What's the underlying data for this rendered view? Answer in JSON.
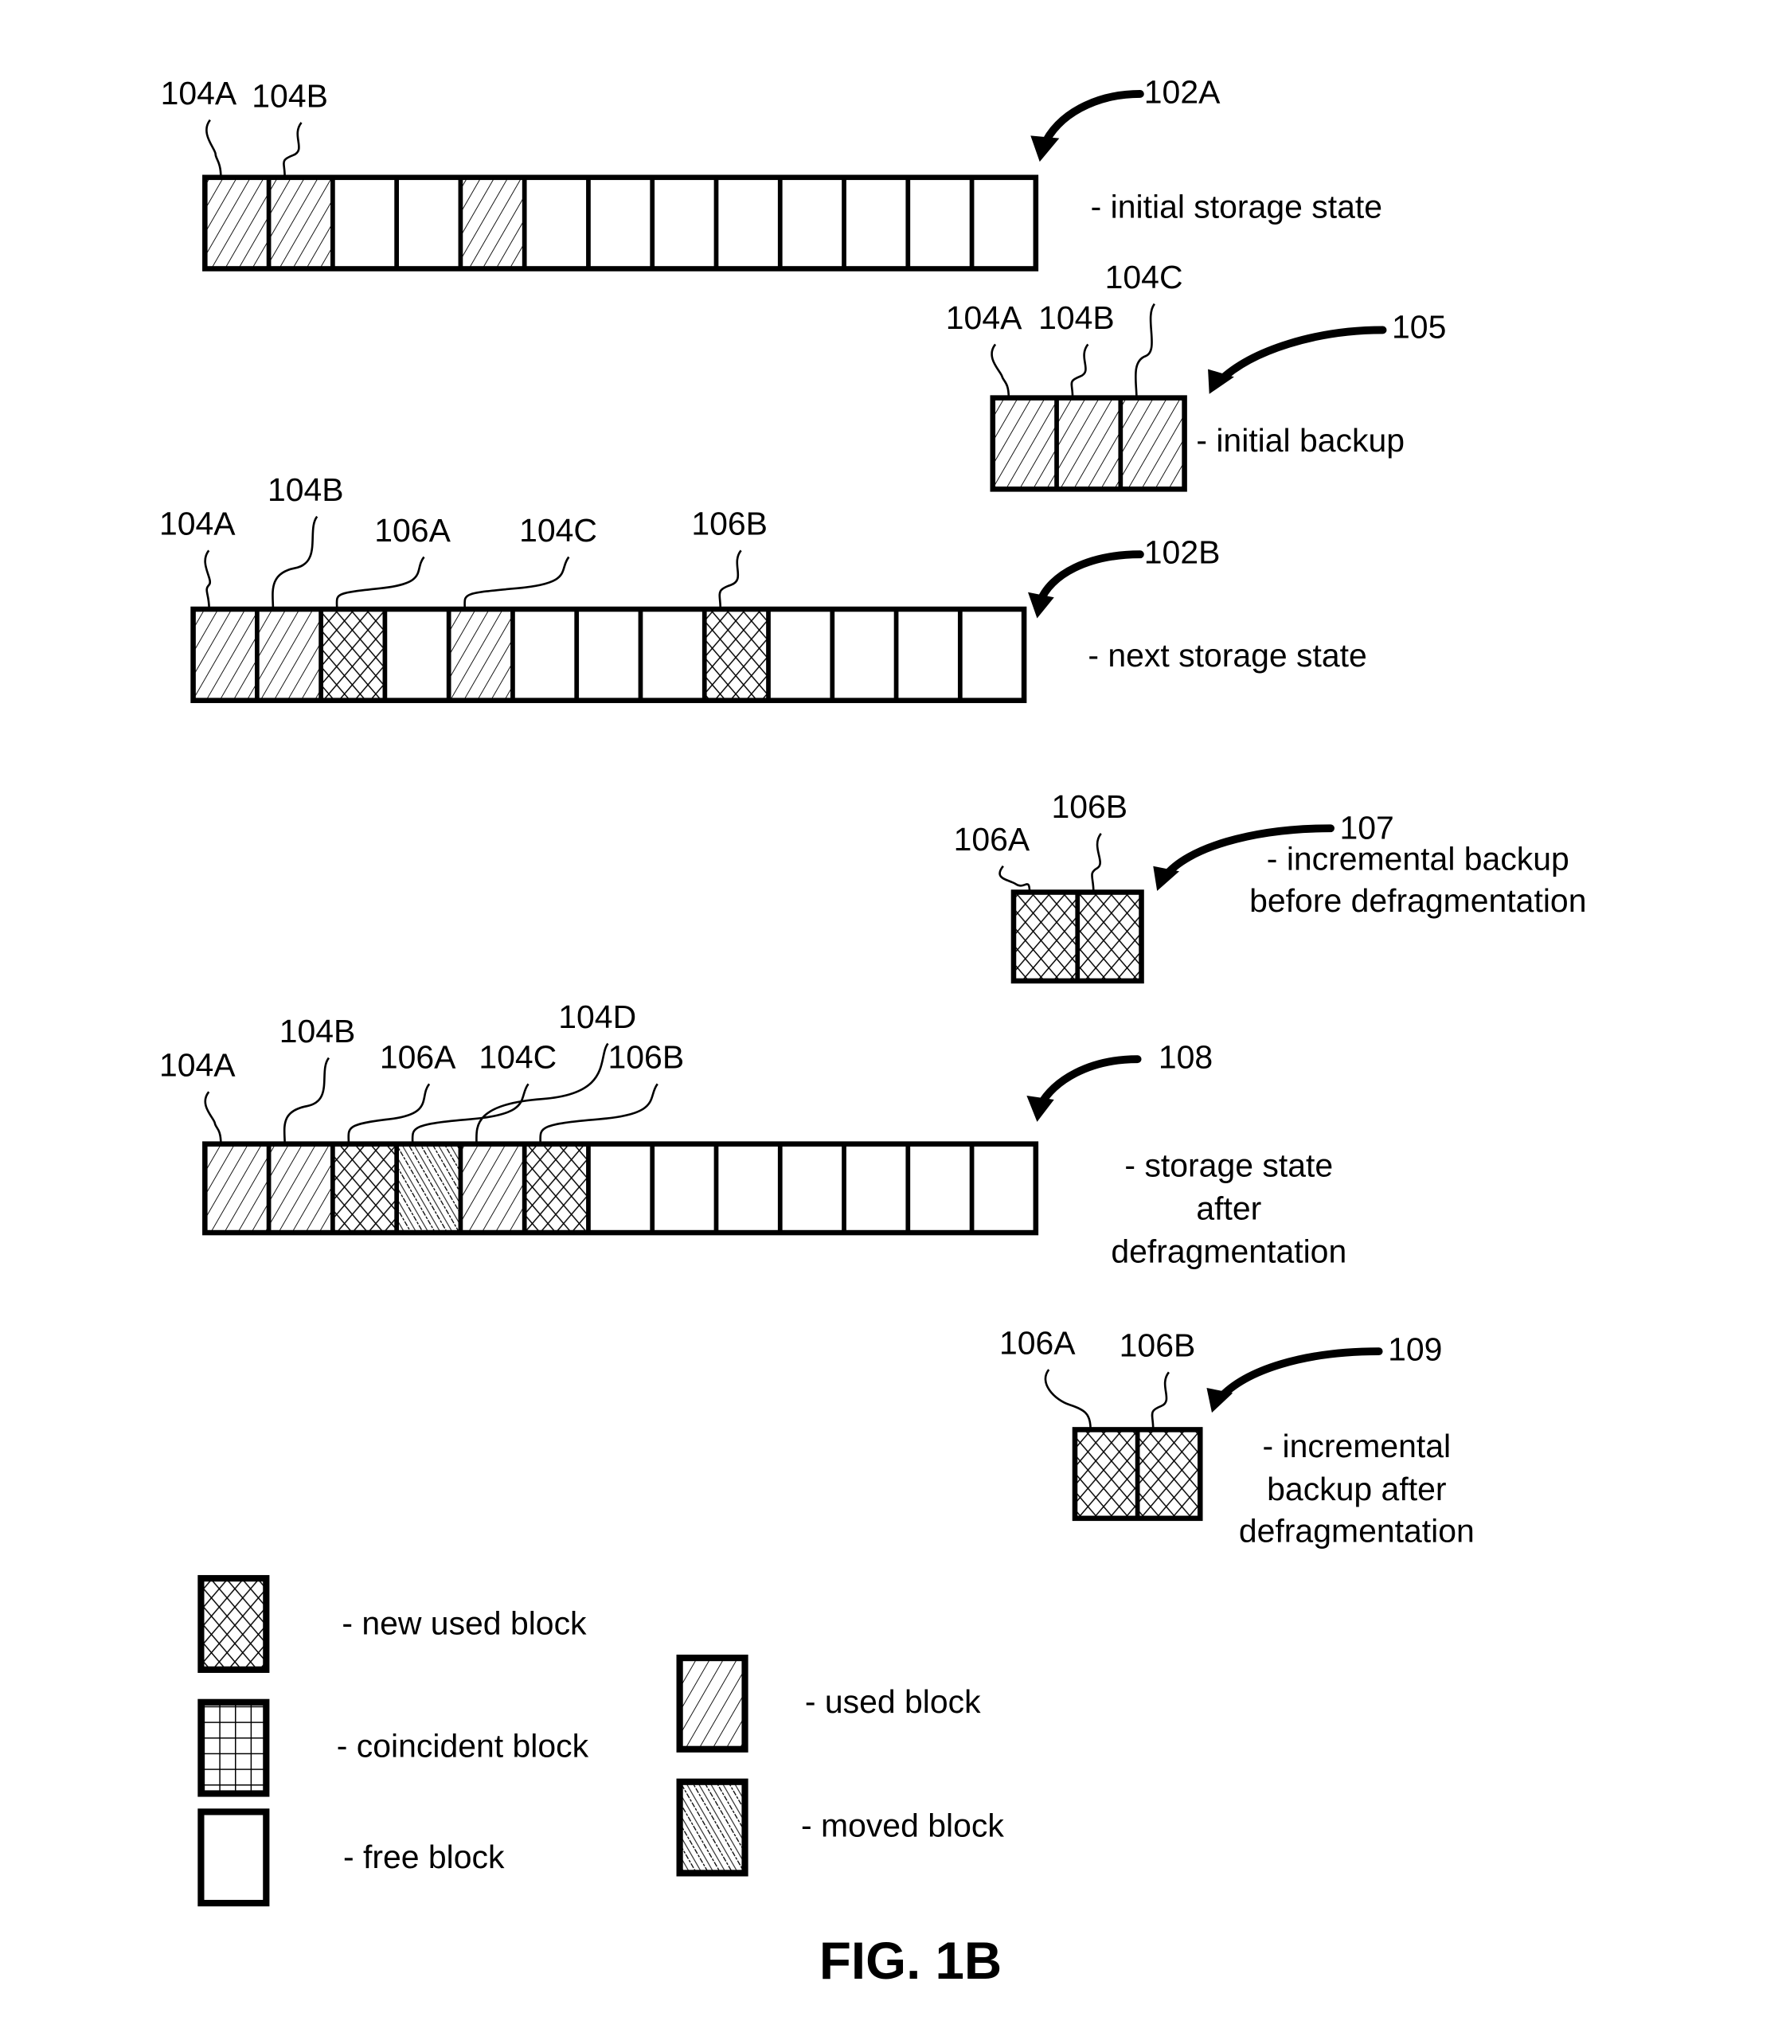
{
  "figure_title": "FIG. 1B",
  "colors": {
    "ink": "#000000",
    "background": "#ffffff"
  },
  "block_types": {
    "used": "used block",
    "new": "new used block",
    "coincident": "coincident block",
    "free": "free block",
    "moved": "moved block"
  },
  "rows": [
    {
      "id": "102A",
      "ref": "102A",
      "description": [
        "- initial storage state"
      ],
      "blocks": [
        "used",
        "used",
        "free",
        "free",
        "used",
        "free",
        "free",
        "free",
        "free",
        "free",
        "free",
        "free",
        "free"
      ],
      "callouts": [
        {
          "text": "104A",
          "block": 0
        },
        {
          "text": "104B",
          "block": 1
        }
      ]
    },
    {
      "id": "105",
      "ref": "105",
      "description": [
        "- initial backup"
      ],
      "blocks": [
        "used",
        "used",
        "used"
      ],
      "callouts": [
        {
          "text": "104A",
          "block": 0
        },
        {
          "text": "104B",
          "block": 1
        },
        {
          "text": "104C",
          "block": 2
        }
      ]
    },
    {
      "id": "102B",
      "ref": "102B",
      "description": [
        "- next storage state"
      ],
      "blocks": [
        "used",
        "used",
        "new",
        "free",
        "used",
        "free",
        "free",
        "free",
        "new",
        "free",
        "free",
        "free",
        "free"
      ],
      "callouts": [
        {
          "text": "104A",
          "block": 0
        },
        {
          "text": "104B",
          "block": 1
        },
        {
          "text": "106A",
          "block": 2
        },
        {
          "text": "104C",
          "block": 4
        },
        {
          "text": "106B",
          "block": 8
        }
      ]
    },
    {
      "id": "107",
      "ref": "107",
      "description": [
        "- incremental backup",
        "before defragmentation"
      ],
      "blocks": [
        "new",
        "new"
      ],
      "callouts": [
        {
          "text": "106A",
          "block": 0
        },
        {
          "text": "106B",
          "block": 1
        }
      ]
    },
    {
      "id": "108",
      "ref": "108",
      "description": [
        "- storage state",
        "after",
        "defragmentation"
      ],
      "blocks": [
        "used",
        "used",
        "new",
        "moved",
        "used",
        "new",
        "free",
        "free",
        "free",
        "free",
        "free",
        "free",
        "free"
      ],
      "callouts": [
        {
          "text": "104A",
          "block": 0
        },
        {
          "text": "104B",
          "block": 1
        },
        {
          "text": "106A",
          "block": 2
        },
        {
          "text": "104C",
          "block": 3
        },
        {
          "text": "104D",
          "block": 4
        },
        {
          "text": "106B",
          "block": 5
        }
      ]
    },
    {
      "id": "109",
      "ref": "109",
      "description": [
        "- incremental",
        "backup after",
        "defragmentation"
      ],
      "blocks": [
        "new",
        "new"
      ],
      "callouts": [
        {
          "text": "106A",
          "block": 0
        },
        {
          "text": "106B",
          "block": 1
        }
      ]
    }
  ],
  "legend": [
    {
      "type": "new",
      "label": "- new used block"
    },
    {
      "type": "coincident",
      "label": "- coincident block"
    },
    {
      "type": "free",
      "label": "- free block"
    },
    {
      "type": "used",
      "label": "- used block"
    },
    {
      "type": "moved",
      "label": "- moved block"
    }
  ]
}
